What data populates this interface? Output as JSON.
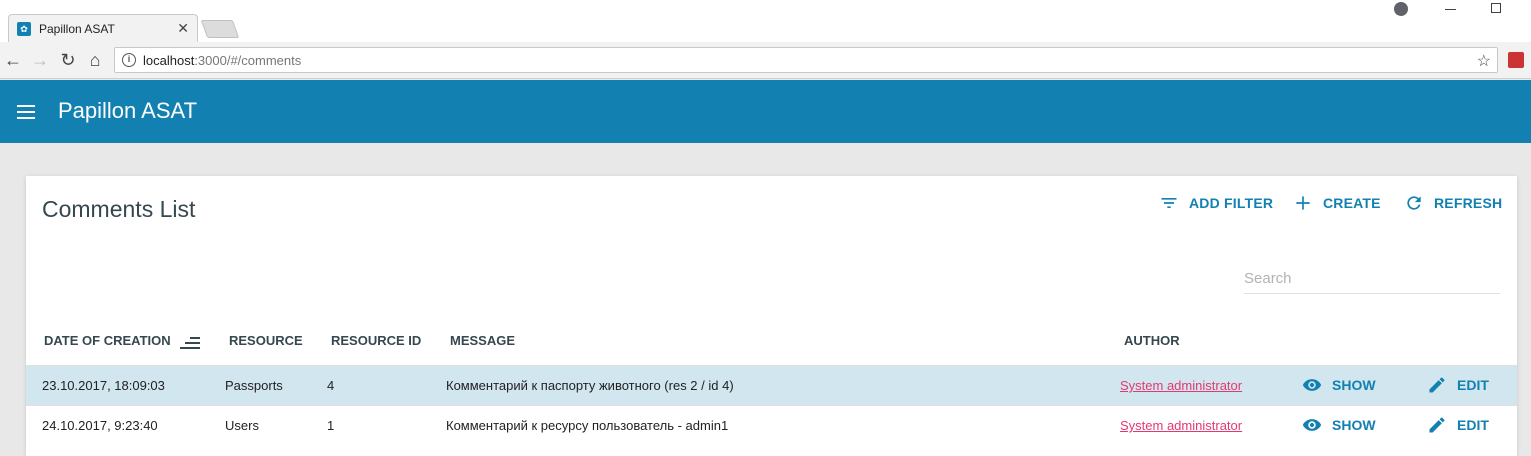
{
  "browser": {
    "tab_title": "Papillon ASAT",
    "url_host": "localhost",
    "url_rest": ":3000/#/comments",
    "close_glyph": "✕"
  },
  "app": {
    "title": "Papillon ASAT",
    "brand_color": "#1281b2"
  },
  "list": {
    "title": "Comments List",
    "actions": {
      "add_filter": "ADD FILTER",
      "create": "CREATE",
      "refresh": "REFRESH"
    },
    "search_placeholder": "Search",
    "columns": {
      "date": "DATE OF CREATION",
      "resource": "RESOURCE",
      "resource_id": "RESOURCE ID",
      "message": "MESSAGE",
      "author": "AUTHOR"
    },
    "rows": [
      {
        "date": "23.10.2017, 18:09:03",
        "resource": "Passports",
        "resource_id": "4",
        "message": "Комментарий к паспорту животного (res 2 / id 4)",
        "author": "System administrator",
        "show": "SHOW",
        "edit": "EDIT"
      },
      {
        "date": "24.10.2017, 9:23:40",
        "resource": "Users",
        "resource_id": "1",
        "message": "Комментарий к ресурсу пользователь - admin1",
        "author": "System administrator",
        "show": "SHOW",
        "edit": "EDIT"
      }
    ]
  }
}
